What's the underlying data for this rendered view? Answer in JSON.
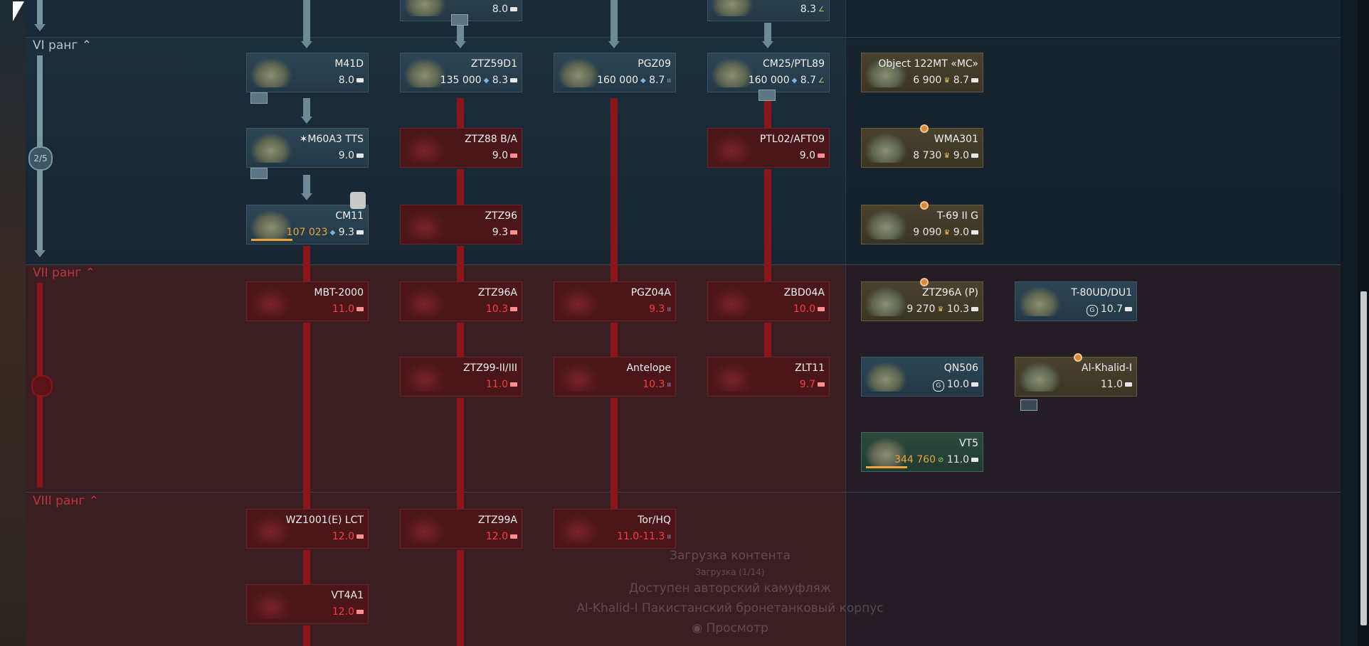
{
  "ranks": {
    "vi": "VI ранг",
    "vii": "VII ранг",
    "viii": "VIII ранг",
    "progress": "2/5"
  },
  "top_cards": {
    "col2_br": "8.0",
    "col4_br": "8.3"
  },
  "vehicles": [
    {
      "id": "m41d",
      "name": "M41D",
      "cost": "",
      "br": "8.0",
      "role": "tank"
    },
    {
      "id": "ztz59d1",
      "name": "ZTZ59D1",
      "cost": "135 000",
      "br": "8.3",
      "role": "medium"
    },
    {
      "id": "pgz09",
      "name": "PGZ09",
      "cost": "160 000",
      "br": "8.7",
      "role": "spaa"
    },
    {
      "id": "cm25",
      "name": "CM25/PTL89",
      "cost": "160 000",
      "br": "8.7",
      "role": "light"
    },
    {
      "id": "m60a3",
      "name": "M60A3 TTS",
      "cost": "",
      "br": "9.0",
      "role": "medium"
    },
    {
      "id": "ztz88",
      "name": "ZTZ88 B/A",
      "cost": "",
      "br": "9.0",
      "role": "medium"
    },
    {
      "id": "ptl02",
      "name": "PTL02/AFT09",
      "cost": "",
      "br": "9.0",
      "role": "tank"
    },
    {
      "id": "cm11",
      "name": "CM11",
      "cost": "107 023",
      "br": "9.3",
      "role": "medium"
    },
    {
      "id": "ztz96",
      "name": "ZTZ96",
      "cost": "",
      "br": "9.3",
      "role": "medium"
    },
    {
      "id": "mbt2000",
      "name": "MBT-2000",
      "cost": "",
      "br": "11.0",
      "role": "medium"
    },
    {
      "id": "ztz96a",
      "name": "ZTZ96A",
      "cost": "",
      "br": "10.3",
      "role": "medium"
    },
    {
      "id": "pgz04a",
      "name": "PGZ04A",
      "cost": "",
      "br": "9.3",
      "role": "spaa"
    },
    {
      "id": "zbd04a",
      "name": "ZBD04A",
      "cost": "",
      "br": "10.0",
      "role": "tank"
    },
    {
      "id": "ztz99",
      "name": "ZTZ99-II/III",
      "cost": "",
      "br": "11.0",
      "role": "medium"
    },
    {
      "id": "antelope",
      "name": "Antelope",
      "cost": "",
      "br": "10.3",
      "role": "spaa"
    },
    {
      "id": "zlt11",
      "name": "ZLT11",
      "cost": "",
      "br": "9.7",
      "role": "tank"
    },
    {
      "id": "wz1001",
      "name": "WZ1001(E) LCT",
      "cost": "",
      "br": "12.0",
      "role": "medium"
    },
    {
      "id": "ztz99a",
      "name": "ZTZ99A",
      "cost": "",
      "br": "12.0",
      "role": "medium"
    },
    {
      "id": "torhq",
      "name": "Tor/HQ",
      "cost": "",
      "br": "11.0-11.3",
      "role": "spaa"
    },
    {
      "id": "vt4a1",
      "name": "VT4A1",
      "cost": "",
      "br": "12.0",
      "role": "medium"
    }
  ],
  "premium": [
    {
      "id": "obj122",
      "name": "Object 122MT «MC»",
      "cost": "6 900",
      "br": "8.7"
    },
    {
      "id": "wma301",
      "name": "WMA301",
      "cost": "8 730",
      "br": "9.0"
    },
    {
      "id": "t69",
      "name": "T-69 II G",
      "cost": "9 090",
      "br": "9.0"
    },
    {
      "id": "ztz96ap",
      "name": "ZTZ96A (P)",
      "cost": "9 270",
      "br": "10.3"
    },
    {
      "id": "t80ud",
      "name": "T-80UD/DU1",
      "cost": "",
      "br": "10.7"
    },
    {
      "id": "qn506",
      "name": "QN506",
      "cost": "",
      "br": "10.0"
    },
    {
      "id": "alkhalid",
      "name": "Al-Khalid-I",
      "cost": "",
      "br": "11.0"
    },
    {
      "id": "vt5",
      "name": "VT5",
      "cost": "344 760",
      "br": "11.0"
    }
  ],
  "overlay": {
    "line1": "Загрузка контента",
    "line2": "Загрузка (1/14)",
    "line3": "Доступен авторский камуфляж",
    "line4": "Al-Khalid-I Пакистанский бронетанковый корпус",
    "line5": "Просмотр"
  },
  "icons": {
    "rp": "research-points-icon",
    "ge": "golden-eagle-icon",
    "tank": "medium-tank-icon",
    "spaa": "spaa-icon",
    "light": "light-tank-icon"
  }
}
